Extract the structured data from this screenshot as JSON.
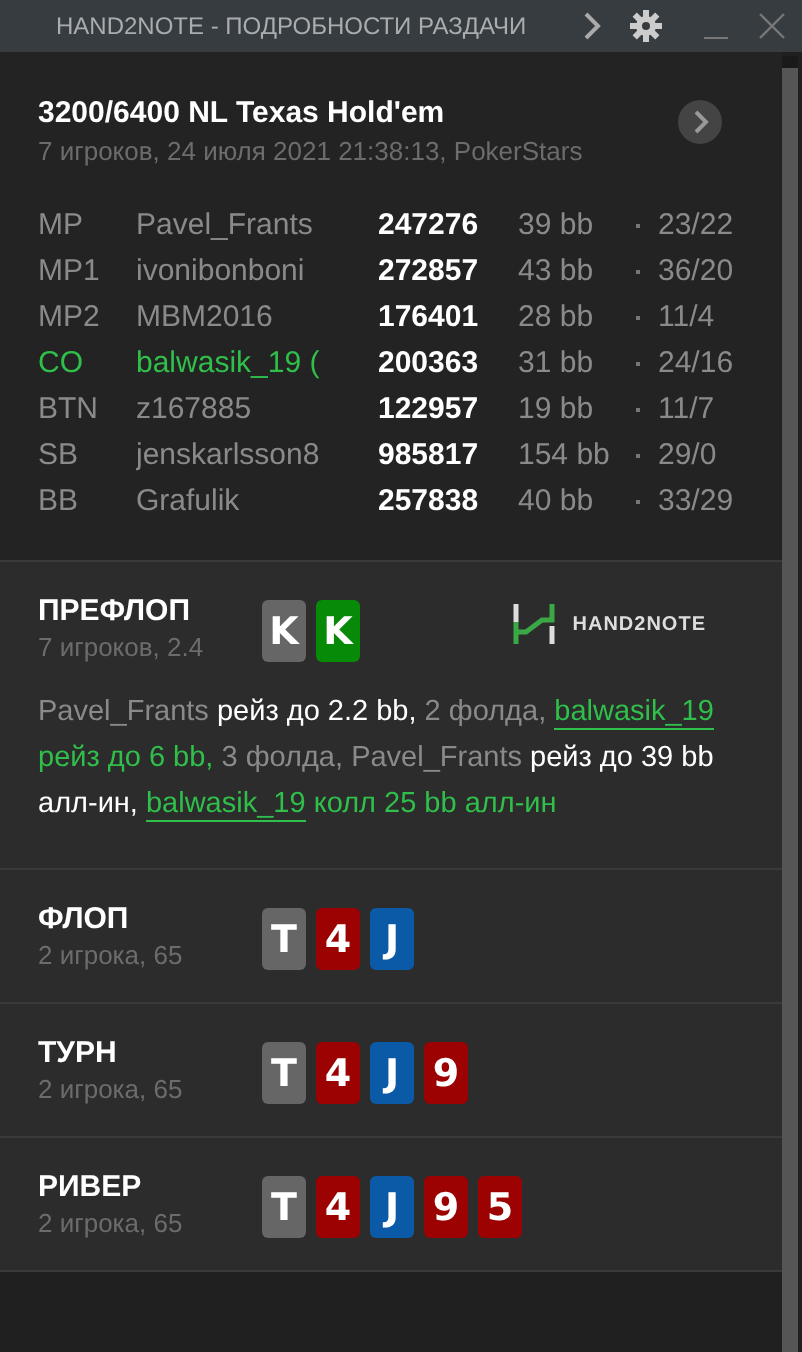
{
  "window": {
    "title": "HAND2NOTE - ПОДРОБНОСТИ РАЗДАЧИ"
  },
  "header": {
    "title": "3200/6400 NL Texas Hold'em",
    "subtitle": "7 игроков, 24 июля 2021 21:38:13, PokerStars"
  },
  "players": [
    {
      "position": "MP",
      "name": "Pavel_Frants",
      "stack": "247276",
      "bb": "39 bb",
      "stat": "23/22",
      "hero": false
    },
    {
      "position": "MP1",
      "name": "ivonibonboni",
      "stack": "272857",
      "bb": "43 bb",
      "stat": "36/20",
      "hero": false
    },
    {
      "position": "MP2",
      "name": "MBM2016",
      "stack": "176401",
      "bb": "28 bb",
      "stat": "11/4",
      "hero": false
    },
    {
      "position": "CO",
      "name": "balwasik_19",
      "name_suffix": "(",
      "stack": "200363",
      "bb": "31 bb",
      "stat": "24/16",
      "hero": true
    },
    {
      "position": "BTN",
      "name": "z167885",
      "stack": "122957",
      "bb": "19 bb",
      "stat": "11/7",
      "hero": false
    },
    {
      "position": "SB",
      "name": "jenskarlsson8",
      "stack": "985817",
      "bb": "154 bb",
      "stat": "29/0",
      "hero": false
    },
    {
      "position": "BB",
      "name": "Grafulik",
      "stack": "257838",
      "bb": "40 bb",
      "stat": "33/29",
      "hero": false
    }
  ],
  "streets": [
    {
      "name": "ПРЕФЛОП",
      "info": "7 игроков, 2.4",
      "cards": [
        {
          "rank": "K",
          "color": "#666666"
        },
        {
          "rank": "K",
          "color": "#078a07"
        }
      ],
      "logo": {
        "text": "HAND2NOTE"
      },
      "actions": [
        {
          "kind": "player",
          "text": "Pavel_Frants",
          "hero": false
        },
        {
          "kind": "action",
          "text": " рейз до 2.2 bb,",
          "hero": false
        },
        {
          "kind": "fold",
          "text": " 2 фолда, ",
          "hero": false
        },
        {
          "kind": "player",
          "text": "balwasik_19",
          "hero": true
        },
        {
          "kind": "action",
          "text": " рейз до 6 bb,",
          "hero": true
        },
        {
          "kind": "fold",
          "text": " 3 фолда, ",
          "hero": false
        },
        {
          "kind": "player",
          "text": "Pavel_Frants",
          "hero": false
        },
        {
          "kind": "action",
          "text": " рейз до 39 bb алл-ин, ",
          "hero": false
        },
        {
          "kind": "player",
          "text": "balwasik_19",
          "hero": true
        },
        {
          "kind": "action",
          "text": " колл 25 bb алл-ин",
          "hero": true
        }
      ]
    },
    {
      "name": "ФЛОП",
      "info": "2 игрока, 65",
      "cards": [
        {
          "rank": "T",
          "color": "#666666"
        },
        {
          "rank": "4",
          "color": "#9c0202"
        },
        {
          "rank": "J",
          "color": "#0a5aa8"
        }
      ]
    },
    {
      "name": "ТУРН",
      "info": "2 игрока, 65",
      "cards": [
        {
          "rank": "T",
          "color": "#666666"
        },
        {
          "rank": "4",
          "color": "#9c0202"
        },
        {
          "rank": "J",
          "color": "#0a5aa8"
        },
        {
          "rank": "9",
          "color": "#9c0202"
        }
      ]
    },
    {
      "name": "РИВЕР",
      "info": "2 игрока, 65",
      "cards": [
        {
          "rank": "T",
          "color": "#666666"
        },
        {
          "rank": "4",
          "color": "#9c0202"
        },
        {
          "rank": "J",
          "color": "#0a5aa8"
        },
        {
          "rank": "9",
          "color": "#9c0202"
        },
        {
          "rank": "5",
          "color": "#9c0202"
        }
      ]
    }
  ]
}
